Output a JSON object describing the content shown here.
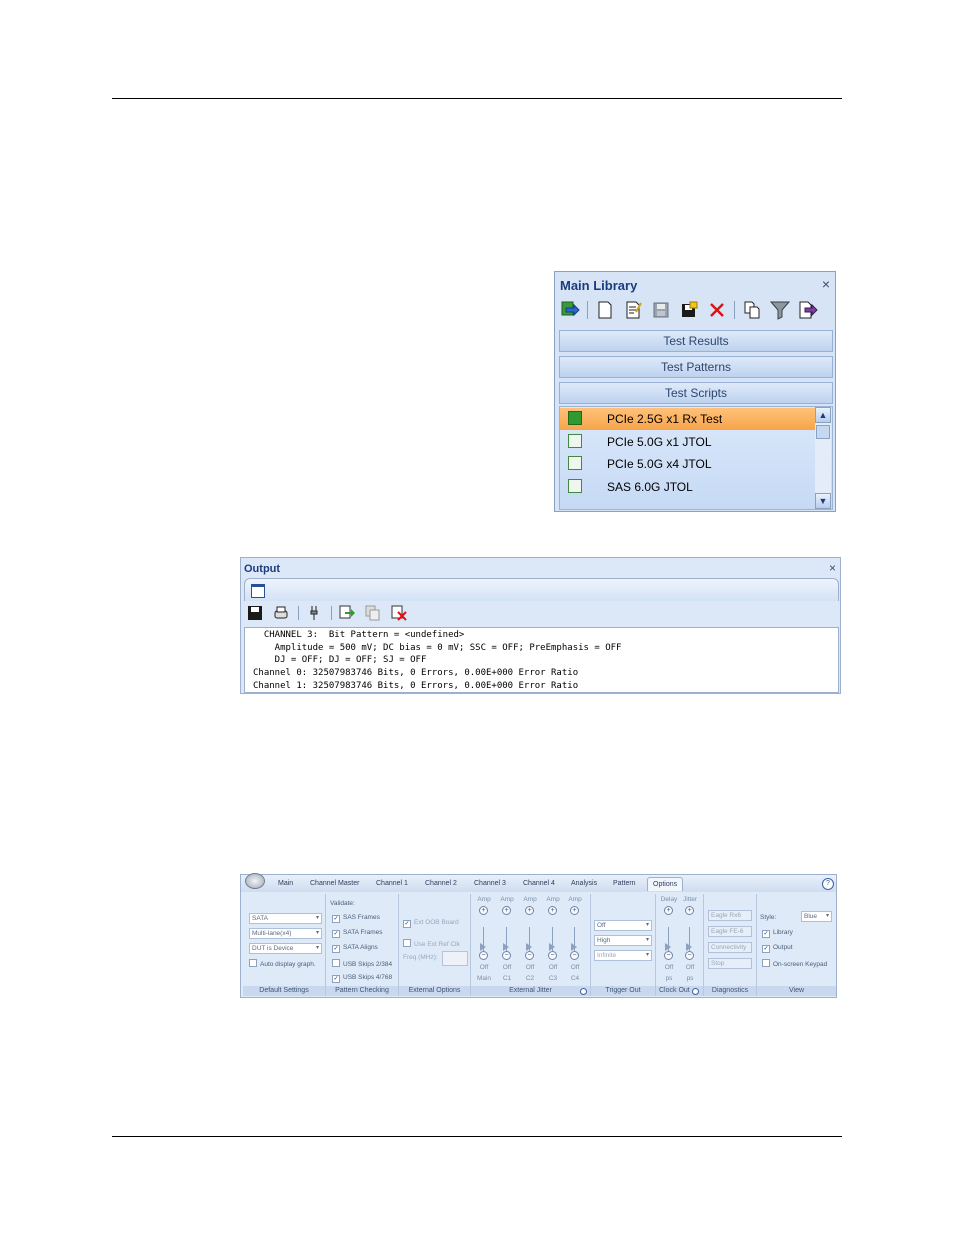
{
  "library": {
    "title": "Main Library",
    "close": "×",
    "sections": [
      "Test Results",
      "Test Patterns",
      "Test Scripts"
    ],
    "items": [
      {
        "label": "PCIe 2.5G x1 Rx Test",
        "selected": true
      },
      {
        "label": "PCIe 5.0G x1 JTOL",
        "selected": false
      },
      {
        "label": "PCIe 5.0G x4 JTOL",
        "selected": false
      },
      {
        "label": "SAS 6.0G JTOL",
        "selected": false
      }
    ],
    "toolbar_icons": [
      "import-icon",
      "new-icon",
      "edit-icon",
      "save-icon",
      "save-all-icon",
      "delete-icon",
      "copy-icon",
      "filter-icon",
      "export-icon"
    ]
  },
  "output": {
    "title": "Output",
    "close": "×",
    "lines": [
      "  CHANNEL 3:  Bit Pattern = <undefined>",
      "    Amplitude = 500 mV; DC bias = 0 mV; SSC = OFF; PreEmphasis = OFF",
      "    DJ = OFF; DJ = OFF; SJ = OFF",
      "Channel 0: 32507983746 Bits, 0 Errors, 0.00E+000 Error Ratio",
      "Channel 1: 32507983746 Bits, 0 Errors, 0.00E+000 Error Ratio"
    ]
  },
  "ribbon": {
    "tabs": [
      "Main",
      "Channel Master",
      "Channel 1",
      "Channel 2",
      "Channel 3",
      "Channel 4",
      "Analysis",
      "Pattern",
      "Options"
    ],
    "active_tab": "Options",
    "default_settings": {
      "combo1": "SATA",
      "combo2": "Multi-lane(x4)",
      "combo3": "DUT is Device",
      "auto_display": "Auto display graph.",
      "label": "Default Settings"
    },
    "pattern_checking": {
      "header": "Validate:",
      "items": [
        "SAS Frames",
        "SATA Frames",
        "SATA Aligns",
        "USB Skips 2/384",
        "USB Skips 4/768"
      ],
      "label": "Pattern Checking"
    },
    "external_options": {
      "ext_oob": "Ext OOB Board",
      "use_ext_ref": "Use Ext Ref Clk",
      "freq": "Freq (MHz):",
      "label": "External Options"
    },
    "external_jitter": {
      "sliders": [
        {
          "top": "Amp",
          "value": "Off",
          "name": "Main"
        },
        {
          "top": "Amp",
          "value": "Off",
          "name": "C1"
        },
        {
          "top": "Amp",
          "value": "Off",
          "name": "C2"
        },
        {
          "top": "Amp",
          "value": "Off",
          "name": "C3"
        },
        {
          "top": "Amp",
          "value": "Off",
          "name": "C4"
        }
      ],
      "label": "External Jitter"
    },
    "trigger_out": {
      "combo1": "Off",
      "combo2": "High",
      "combo3": "Infinite",
      "label": "Trigger Out"
    },
    "clock_out": {
      "sliders": [
        {
          "top": "Delay",
          "value": "Off",
          "name": "ps"
        },
        {
          "top": "Jitter",
          "value": "Off",
          "name": "ps"
        }
      ],
      "label": "Clock Out"
    },
    "diagnostics": {
      "buttons": [
        "Eagle Rx6",
        "Eagle FE-6",
        "Connectivity",
        "Stop"
      ],
      "label": "Diagnostics"
    },
    "view": {
      "style_label": "Style:",
      "style_value": "Blue",
      "library": "Library",
      "output": "Output",
      "keypad": "On-screen Keypad",
      "label": "View"
    }
  }
}
